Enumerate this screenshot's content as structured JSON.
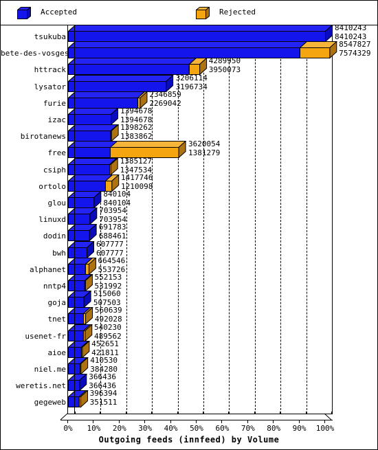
{
  "legend": {
    "items": [
      {
        "label": "Accepted",
        "color": "#1414ec",
        "icon": "cube-icon"
      },
      {
        "label": "Rejected",
        "color": "#f5a510",
        "icon": "cube-icon"
      }
    ]
  },
  "colors": {
    "accepted": "#1414ec",
    "accepted_top": "#2323f4",
    "accepted_side": "#0b0bbe",
    "rejected": "#f5a510",
    "rejected_top": "#f7b43a",
    "rejected_side": "#ad7310",
    "axis": "#000000",
    "background": "#ffffff"
  },
  "axis": {
    "title": "Outgoing feeds (innfeed) by Volume",
    "xticks": [
      "0%",
      "10%",
      "20%",
      "30%",
      "40%",
      "50%",
      "60%",
      "70%",
      "80%",
      "90%",
      "100%"
    ],
    "xmin_pct": 0,
    "xmax_pct": 100
  },
  "chart_data": {
    "type": "bar",
    "orientation": "horizontal",
    "stacked": true,
    "title": "Outgoing feeds (innfeed) by Volume",
    "xlabel": "Outgoing feeds (innfeed) by Volume",
    "ylabel": "",
    "xlim": [
      0,
      100
    ],
    "xunit": "percent",
    "grid": true,
    "legend_position": "top",
    "categories": [
      "tsukuba",
      "bete-des-vosges",
      "httrack",
      "lysator",
      "furie",
      "izac",
      "birotanews",
      "free",
      "csiph",
      "ortolo",
      "glou",
      "linuxd",
      "dodin",
      "bwh",
      "alphanet",
      "nntp4",
      "goja",
      "tnet",
      "usenet-fr",
      "aioe",
      "niel.me",
      "weretis.net",
      "gegeweb"
    ],
    "series": [
      {
        "name": "Accepted",
        "values": [
          8410243,
          7574329,
          3950073,
          3196734,
          2269042,
          1394678,
          1383862,
          1381279,
          1347534,
          1210098,
          840104,
          703954,
          688461,
          607777,
          553726,
          531992,
          507503,
          492028,
          489562,
          421811,
          384280,
          366436,
          351511
        ]
      },
      {
        "name": "Rejected",
        "values": [
          0,
          973498,
          339877,
          9380,
          77817,
          0,
          14400,
          2238775,
          37593,
          207648,
          0,
          0,
          3322,
          0,
          110820,
          20161,
          7557,
          68611,
          50668,
          30840,
          26250,
          0,
          44883
        ]
      }
    ],
    "totals": [
      8410243,
      8547827,
      4289950,
      3206114,
      2346859,
      1394678,
      1398262,
      3620054,
      1385127,
      1417746,
      840104,
      703954,
      691783,
      607777,
      664546,
      552153,
      515060,
      560639,
      540230,
      452651,
      410530,
      366436,
      396394
    ],
    "scale_max": 8410243,
    "rows": [
      {
        "label": "tsukuba",
        "total": 8410243,
        "accepted": 8410243,
        "total_text": "8410243",
        "accepted_text": "8410243"
      },
      {
        "label": "bete-des-vosges",
        "total": 8547827,
        "accepted": 7574329,
        "total_text": "8547827",
        "accepted_text": "7574329"
      },
      {
        "label": "httrack",
        "total": 4289950,
        "accepted": 3950073,
        "total_text": "4289950",
        "accepted_text": "3950073"
      },
      {
        "label": "lysator",
        "total": 3206114,
        "accepted": 3196734,
        "total_text": "3206114",
        "accepted_text": "3196734"
      },
      {
        "label": "furie",
        "total": 2346859,
        "accepted": 2269042,
        "total_text": "2346859",
        "accepted_text": "2269042"
      },
      {
        "label": "izac",
        "total": 1394678,
        "accepted": 1394678,
        "total_text": "1394678",
        "accepted_text": "1394678"
      },
      {
        "label": "birotanews",
        "total": 1398262,
        "accepted": 1383862,
        "total_text": "1398262",
        "accepted_text": "1383862"
      },
      {
        "label": "free",
        "total": 3620054,
        "accepted": 1381279,
        "total_text": "3620054",
        "accepted_text": "1381279"
      },
      {
        "label": "csiph",
        "total": 1385127,
        "accepted": 1347534,
        "total_text": "1385127",
        "accepted_text": "1347534"
      },
      {
        "label": "ortolo",
        "total": 1417746,
        "accepted": 1210098,
        "total_text": "1417746",
        "accepted_text": "1210098"
      },
      {
        "label": "glou",
        "total": 840104,
        "accepted": 840104,
        "total_text": "840104",
        "accepted_text": "840104"
      },
      {
        "label": "linuxd",
        "total": 703954,
        "accepted": 703954,
        "total_text": "703954",
        "accepted_text": "703954"
      },
      {
        "label": "dodin",
        "total": 691783,
        "accepted": 688461,
        "total_text": "691783",
        "accepted_text": "688461"
      },
      {
        "label": "bwh",
        "total": 607777,
        "accepted": 607777,
        "total_text": "607777",
        "accepted_text": "607777"
      },
      {
        "label": "alphanet",
        "total": 664546,
        "accepted": 553726,
        "total_text": "664546",
        "accepted_text": "553726"
      },
      {
        "label": "nntp4",
        "total": 552153,
        "accepted": 531992,
        "total_text": "552153",
        "accepted_text": "531992"
      },
      {
        "label": "goja",
        "total": 515060,
        "accepted": 507503,
        "total_text": "515060",
        "accepted_text": "507503"
      },
      {
        "label": "tnet",
        "total": 560639,
        "accepted": 492028,
        "total_text": "560639",
        "accepted_text": "492028"
      },
      {
        "label": "usenet-fr",
        "total": 540230,
        "accepted": 489562,
        "total_text": "540230",
        "accepted_text": "489562"
      },
      {
        "label": "aioe",
        "total": 452651,
        "accepted": 421811,
        "total_text": "452651",
        "accepted_text": "421811"
      },
      {
        "label": "niel.me",
        "total": 410530,
        "accepted": 384280,
        "total_text": "410530",
        "accepted_text": "384280"
      },
      {
        "label": "weretis.net",
        "total": 366436,
        "accepted": 366436,
        "total_text": "366436",
        "accepted_text": "366436"
      },
      {
        "label": "gegeweb",
        "total": 396394,
        "accepted": 351511,
        "total_text": "396394",
        "accepted_text": "351511"
      }
    ]
  }
}
